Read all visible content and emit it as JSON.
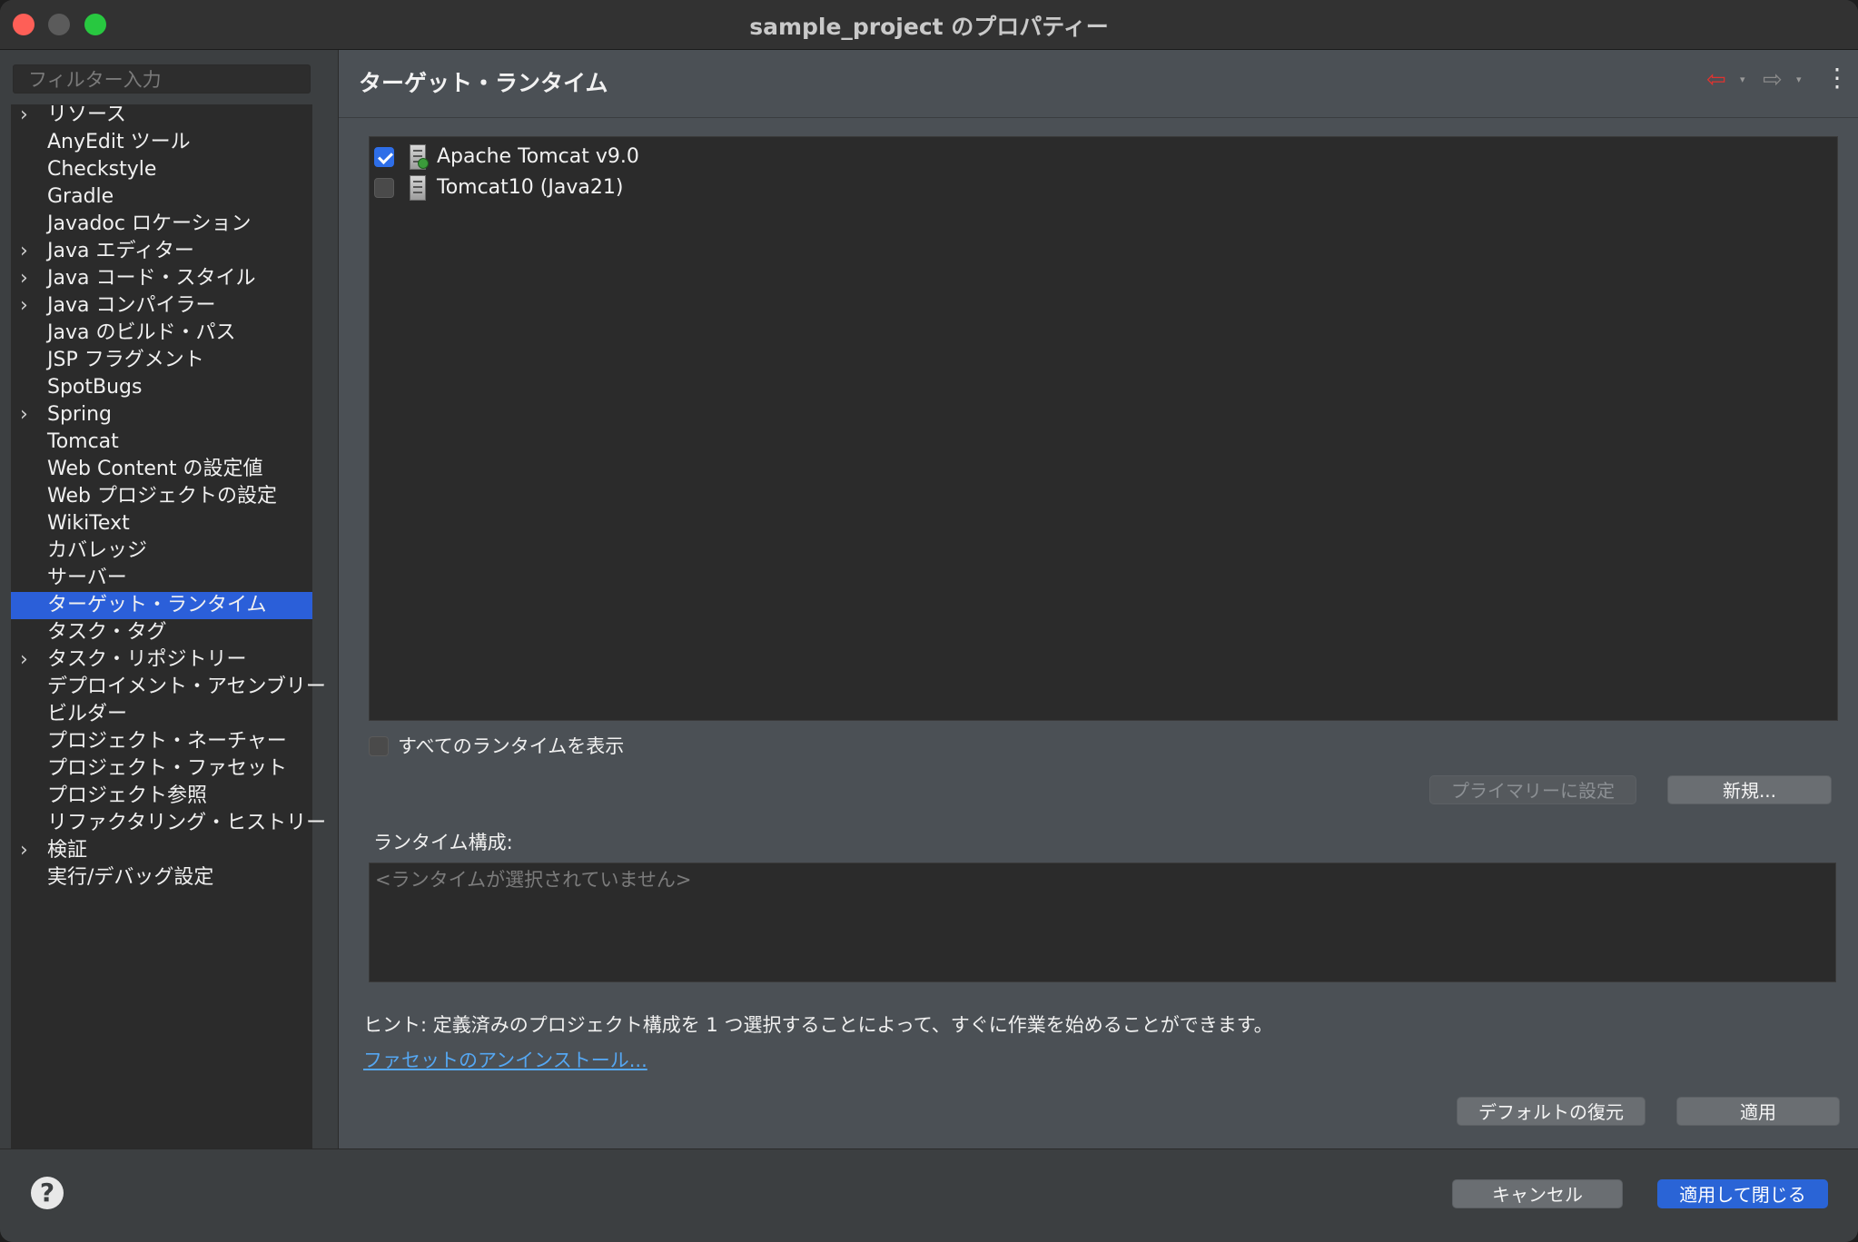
{
  "window": {
    "title": "sample_project のプロパティー"
  },
  "filter": {
    "placeholder": "フィルター入力"
  },
  "tree": {
    "items": [
      {
        "label": "リソース",
        "expandable": true
      },
      {
        "label": "AnyEdit ツール",
        "expandable": false
      },
      {
        "label": "Checkstyle",
        "expandable": false
      },
      {
        "label": "Gradle",
        "expandable": false
      },
      {
        "label": "Javadoc ロケーション",
        "expandable": false
      },
      {
        "label": "Java エディター",
        "expandable": true
      },
      {
        "label": "Java コード・スタイル",
        "expandable": true
      },
      {
        "label": "Java コンパイラー",
        "expandable": true
      },
      {
        "label": "Java のビルド・パス",
        "expandable": false
      },
      {
        "label": "JSP フラグメント",
        "expandable": false
      },
      {
        "label": "SpotBugs",
        "expandable": false
      },
      {
        "label": "Spring",
        "expandable": true
      },
      {
        "label": "Tomcat",
        "expandable": false
      },
      {
        "label": "Web Content の設定値",
        "expandable": false
      },
      {
        "label": "Web プロジェクトの設定",
        "expandable": false
      },
      {
        "label": "WikiText",
        "expandable": false
      },
      {
        "label": "カバレッジ",
        "expandable": false
      },
      {
        "label": "サーバー",
        "expandable": false
      },
      {
        "label": "ターゲット・ランタイム",
        "expandable": false,
        "selected": true
      },
      {
        "label": "タスク・タグ",
        "expandable": false
      },
      {
        "label": "タスク・リポジトリー",
        "expandable": true
      },
      {
        "label": "デプロイメント・アセンブリー",
        "expandable": false
      },
      {
        "label": "ビルダー",
        "expandable": false
      },
      {
        "label": "プロジェクト・ネーチャー",
        "expandable": false
      },
      {
        "label": "プロジェクト・ファセット",
        "expandable": false
      },
      {
        "label": "プロジェクト参照",
        "expandable": false
      },
      {
        "label": "リファクタリング・ヒストリー",
        "expandable": false
      },
      {
        "label": "検証",
        "expandable": true
      },
      {
        "label": "実行/デバッグ設定",
        "expandable": false
      }
    ]
  },
  "page": {
    "title": "ターゲット・ランタイム",
    "back_glyph": "⇦",
    "forward_glyph": "⇨",
    "dropdown_glyph": "▾",
    "menu_glyph": "⋮"
  },
  "runtimes": [
    {
      "label": "Apache Tomcat v9.0",
      "checked": true,
      "icon": "server-icon"
    },
    {
      "label": "Tomcat10 (Java21)",
      "checked": false,
      "icon": "server-icon"
    }
  ],
  "show_all": {
    "label": "すべてのランタイムを表示",
    "checked": false
  },
  "buttons": {
    "set_primary": "プライマリーに設定",
    "new": "新規...",
    "restore_defaults": "デフォルトの復元",
    "apply": "適用",
    "cancel": "キャンセル",
    "apply_and_close": "適用して閉じる"
  },
  "runtime_config": {
    "label": "ランタイム構成:",
    "placeholder": "<ランタイムが選択されていません>"
  },
  "hint": "ヒント: 定義済みのプロジェクト構成を 1 つ選択することによって、すぐに作業を始めることができます。",
  "uninstall_link": "ファセットのアンインストール...",
  "help_glyph": "?",
  "colors": {
    "accent": "#2a64d6",
    "selection": "#2b5fd9",
    "link": "#55a7f2",
    "back_arrow": "#e0332f"
  }
}
